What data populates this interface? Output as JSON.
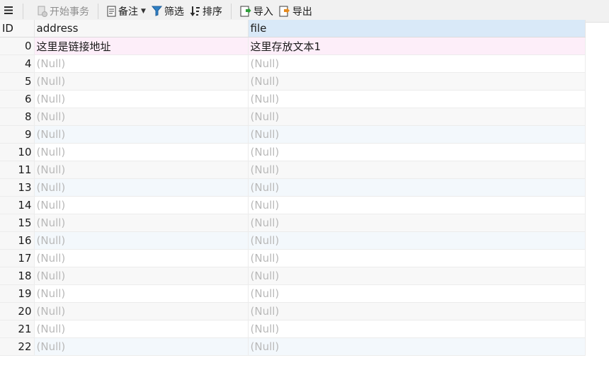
{
  "toolbar": {
    "begin_transaction": "开始事务",
    "memo": "备注",
    "filter": "筛选",
    "sort": "排序",
    "import": "导入",
    "export": "导出"
  },
  "columns": [
    "ID",
    "address",
    "file"
  ],
  "rows": [
    {
      "id": "0",
      "address": "这里是链接地址",
      "file": "这里存放文本1"
    },
    {
      "id": "4",
      "address": "(Null)",
      "file": "(Null)"
    },
    {
      "id": "5",
      "address": "(Null)",
      "file": "(Null)"
    },
    {
      "id": "6",
      "address": "(Null)",
      "file": "(Null)"
    },
    {
      "id": "8",
      "address": "(Null)",
      "file": "(Null)"
    },
    {
      "id": "9",
      "address": "(Null)",
      "file": "(Null)"
    },
    {
      "id": "10",
      "address": "(Null)",
      "file": "(Null)"
    },
    {
      "id": "11",
      "address": "(Null)",
      "file": "(Null)"
    },
    {
      "id": "13",
      "address": "(Null)",
      "file": "(Null)"
    },
    {
      "id": "14",
      "address": "(Null)",
      "file": "(Null)"
    },
    {
      "id": "15",
      "address": "(Null)",
      "file": "(Null)"
    },
    {
      "id": "16",
      "address": "(Null)",
      "file": "(Null)"
    },
    {
      "id": "17",
      "address": "(Null)",
      "file": "(Null)"
    },
    {
      "id": "18",
      "address": "(Null)",
      "file": "(Null)"
    },
    {
      "id": "19",
      "address": "(Null)",
      "file": "(Null)"
    },
    {
      "id": "20",
      "address": "(Null)",
      "file": "(Null)"
    },
    {
      "id": "21",
      "address": "(Null)",
      "file": "(Null)"
    },
    {
      "id": "22",
      "address": "(Null)",
      "file": "(Null)"
    }
  ],
  "icons": {
    "menu": "hamburger-icon",
    "begin_transaction": "transaction-icon",
    "memo": "memo-icon",
    "filter": "filter-icon",
    "sort": "sort-icon",
    "import": "import-icon",
    "export": "export-icon"
  },
  "colors": {
    "selected_row": "#fdeef9",
    "header_active": "#d9e9f8",
    "null_text": "#b9b9b9",
    "import_accent": "#2e9e3a",
    "export_accent": "#e58a1e"
  }
}
